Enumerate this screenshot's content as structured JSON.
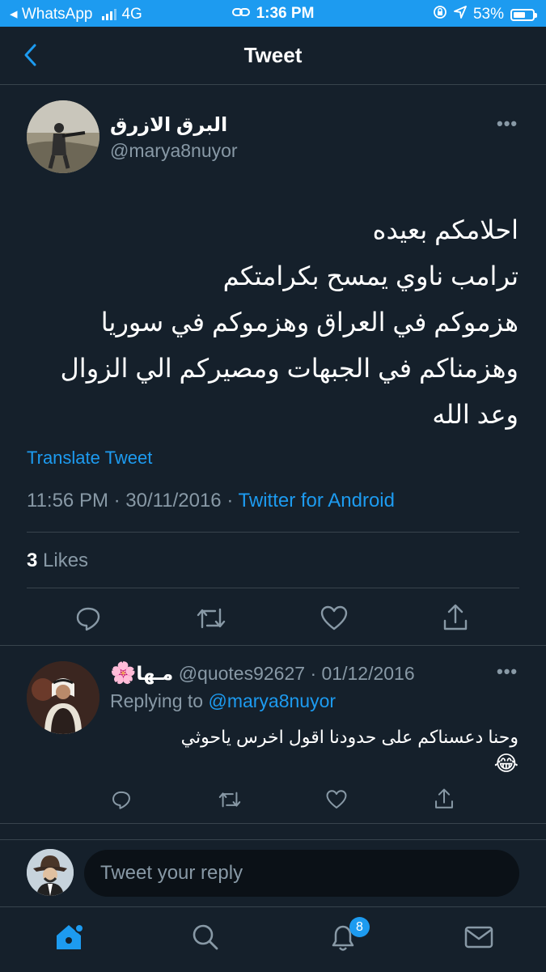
{
  "status_bar": {
    "app": "WhatsApp",
    "network": "4G",
    "time": "1:36 PM",
    "battery": "53%"
  },
  "header": {
    "title": "Tweet",
    "back_icon": "chevron-left-icon"
  },
  "tweet": {
    "author_name": "البرق الازرق",
    "author_handle": "@marya8nuyor",
    "lines": [
      "احلامكم بعيده",
      "ترامب ناوي يمسح بكرامتكم",
      "هزموكم في العراق وهزموكم في سوريا",
      "وهزمناكم في الجبهات ومصيركم الي الزوال",
      "وعد الله"
    ],
    "translate_label": "Translate Tweet",
    "time": "11:56 PM",
    "date": "30/11/2016",
    "source": "Twitter for Android",
    "likes_count": "3",
    "likes_label": "Likes"
  },
  "reply": {
    "name": "مـها",
    "name_emoji": "🌸",
    "handle": "@quotes92627",
    "date": "01/12/2016",
    "replying_label": "Replying to",
    "replying_to": "@marya8nuyor",
    "text": "وحنا دعسناكم على حدودنا اقول اخرس ياحوثي",
    "emoji": "😂"
  },
  "composer": {
    "placeholder": "Tweet your reply"
  },
  "tabbar": {
    "notifications_badge": "8"
  },
  "colors": {
    "background": "#15202b",
    "accent": "#1d9bf0",
    "muted": "#8899a6",
    "divider": "#38444d"
  }
}
